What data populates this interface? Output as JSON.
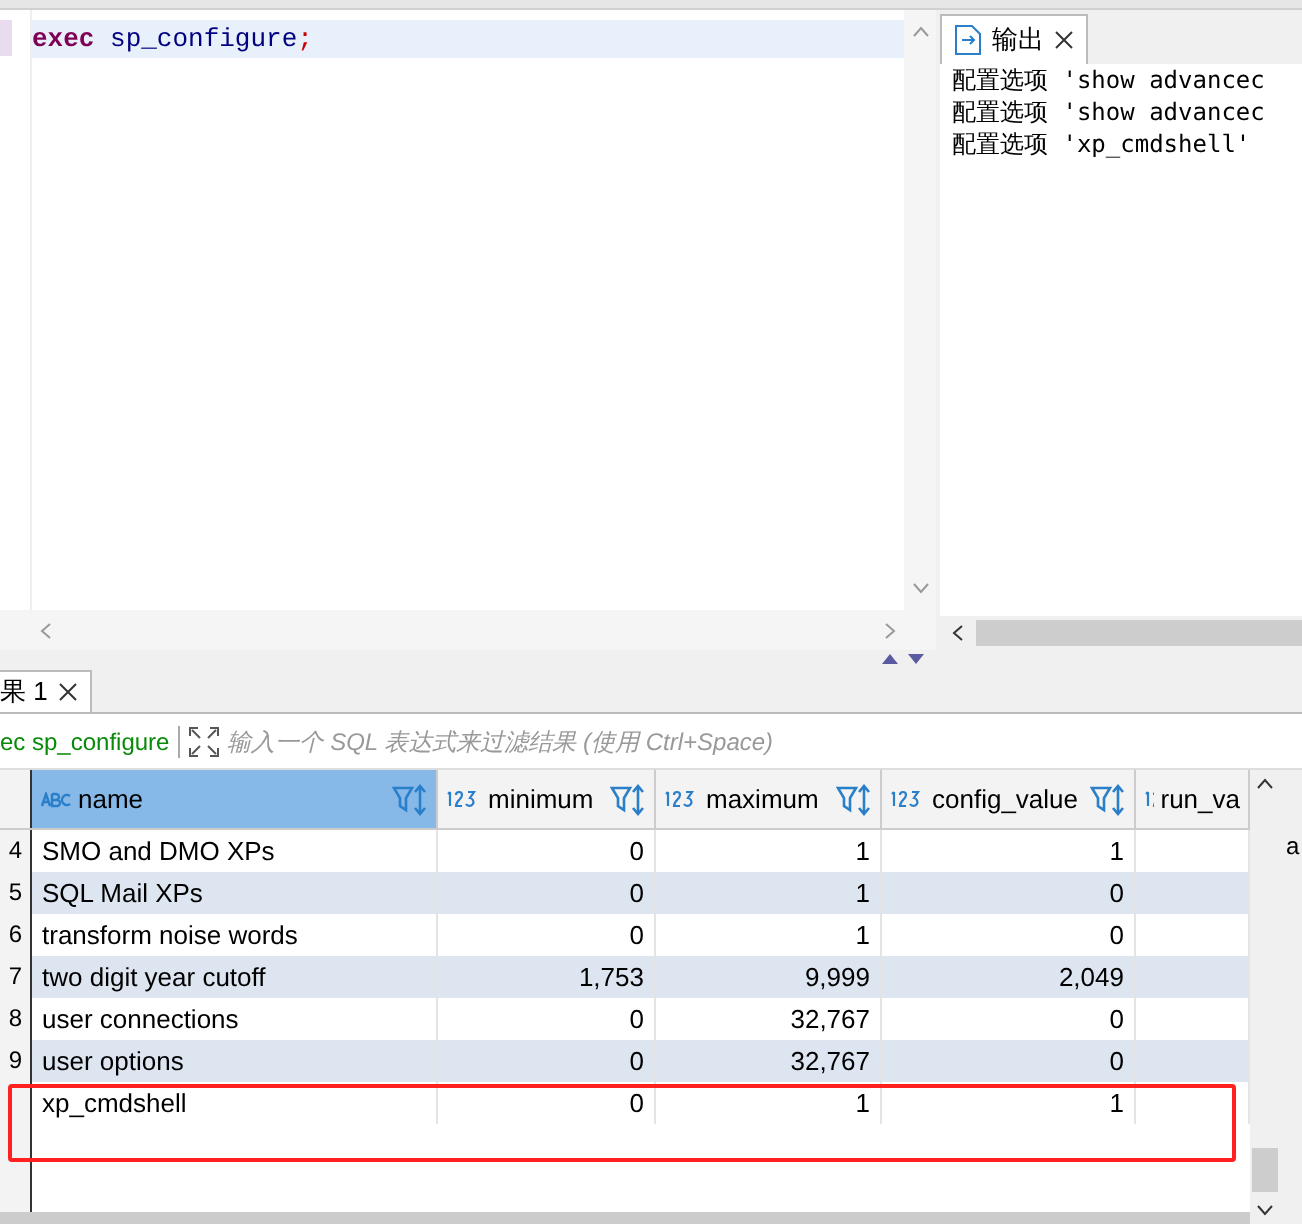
{
  "editor": {
    "code": [
      {
        "kind": "keyword",
        "text": "exec"
      },
      {
        "kind": "plain",
        "text": " sp_configure"
      },
      {
        "kind": "punct",
        "text": ";"
      }
    ]
  },
  "output_panel": {
    "tab": {
      "label": "输出",
      "selected": true
    },
    "lines": [
      "配置选项 'show advancec",
      "配置选项 'show advancec",
      "配置选项 'xp_cmdshell'"
    ]
  },
  "results": {
    "tab": {
      "label": "果 1",
      "selected": true
    },
    "query": "ec sp_configure",
    "filter": {
      "placeholder": "输入一个 SQL 表达式来过滤结果 (使用 Ctrl+Space)"
    },
    "columns": [
      {
        "label": "name",
        "kind": "text",
        "selected": true
      },
      {
        "label": "minimum",
        "kind": "number",
        "selected": false
      },
      {
        "label": "maximum",
        "kind": "number",
        "selected": false
      },
      {
        "label": "config_value",
        "kind": "number",
        "selected": false
      },
      {
        "label": "run_va",
        "kind": "number",
        "selected": false
      }
    ],
    "rows": [
      {
        "num": "4",
        "cells": [
          "SMO and DMO XPs",
          "0",
          "1",
          "1"
        ]
      },
      {
        "num": "5",
        "cells": [
          "SQL Mail XPs",
          "0",
          "1",
          "0"
        ]
      },
      {
        "num": "6",
        "cells": [
          "transform noise words",
          "0",
          "1",
          "0"
        ]
      },
      {
        "num": "7",
        "cells": [
          "two digit year cutoff",
          "1,753",
          "9,999",
          "2,049"
        ]
      },
      {
        "num": "8",
        "cells": [
          "user connections",
          "0",
          "32,767",
          "0"
        ]
      },
      {
        "num": "9",
        "cells": [
          "user options",
          "0",
          "32,767",
          "0"
        ]
      },
      {
        "num": "",
        "cells": [
          "xp_cmdshell",
          "0",
          "1",
          "1"
        ]
      }
    ],
    "side_text": "a"
  }
}
